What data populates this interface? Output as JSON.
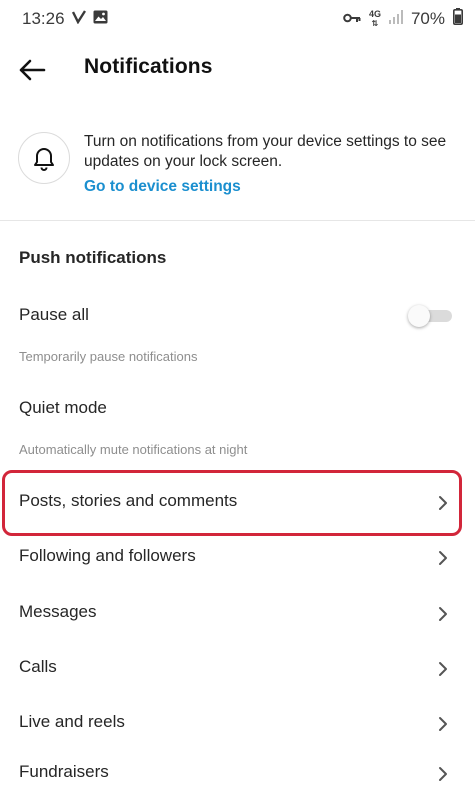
{
  "status_bar": {
    "time": "13:26",
    "network": "4G",
    "battery": "70%"
  },
  "header": {
    "title": "Notifications"
  },
  "banner": {
    "text": "Turn on notifications from your device settings to see updates on your lock screen.",
    "link": "Go to device settings"
  },
  "push": {
    "heading": "Push notifications",
    "pause_all": {
      "label": "Pause all",
      "sub": "Temporarily pause notifications",
      "enabled": false
    },
    "quiet_mode": {
      "label": "Quiet mode",
      "sub": "Automatically mute notifications at night"
    }
  },
  "items": [
    {
      "label": "Posts, stories and comments",
      "highlighted": true
    },
    {
      "label": "Following and followers"
    },
    {
      "label": "Messages"
    },
    {
      "label": "Calls"
    },
    {
      "label": "Live and reels"
    },
    {
      "label": "Fundraisers"
    }
  ],
  "colors": {
    "link": "#1b8fcf",
    "highlight": "#d2263a",
    "toggle_off": "#dbdbdb"
  }
}
